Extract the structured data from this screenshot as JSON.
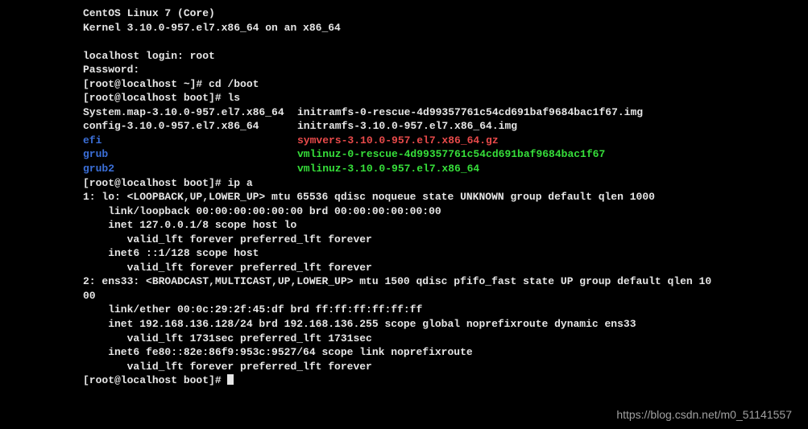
{
  "banner": {
    "line1": "CentOS Linux 7 (Core)",
    "line2": "Kernel 3.10.0-957.el7.x86_64 on an x86_64"
  },
  "login": {
    "prompt": "localhost login: ",
    "user": "root",
    "pw_prompt": "Password:"
  },
  "prompt_home": "[root@localhost ~]# ",
  "prompt_boot": "[root@localhost boot]# ",
  "cmd_cd": "cd /boot",
  "cmd_ls": "ls",
  "cmd_ip": "ip a",
  "ls": {
    "c0r0": "System.map-3.10.0-957.el7.x86_64",
    "c1r0": "initramfs-0-rescue-4d99357761c54cd691baf9684bac1f67.img",
    "c0r1": "config-3.10.0-957.el7.x86_64",
    "c1r1": "initramfs-3.10.0-957.el7.x86_64.img",
    "c0r2": "efi",
    "c1r2": "symvers-3.10.0-957.el7.x86_64.gz",
    "c0r3": "grub",
    "c1r3": "vmlinuz-0-rescue-4d99357761c54cd691baf9684bac1f67",
    "c0r4": "grub2",
    "c1r4": "vmlinuz-3.10.0-957.el7.x86_64"
  },
  "ip": {
    "l1": "1: lo: <LOOPBACK,UP,LOWER_UP> mtu 65536 qdisc noqueue state UNKNOWN group default qlen 1000",
    "l2": "    link/loopback 00:00:00:00:00:00 brd 00:00:00:00:00:00",
    "l3": "    inet 127.0.0.1/8 scope host lo",
    "l4": "       valid_lft forever preferred_lft forever",
    "l5": "    inet6 ::1/128 scope host",
    "l6": "       valid_lft forever preferred_lft forever",
    "l7a": "2: ens33: <BROADCAST,MULTICAST,UP,LOWER_UP> mtu 1500 qdisc pfifo_fast state UP group default qlen 10",
    "l7b": "00",
    "l8": "    link/ether 00:0c:29:2f:45:df brd ff:ff:ff:ff:ff:ff",
    "l9": "    inet 192.168.136.128/24 brd 192.168.136.255 scope global noprefixroute dynamic ens33",
    "l10": "       valid_lft 1731sec preferred_lft 1731sec",
    "l11": "    inet6 fe80::82e:86f9:953c:9527/64 scope link noprefixroute",
    "l12": "       valid_lft forever preferred_lft forever"
  },
  "watermark": "https://blog.csdn.net/m0_51141557"
}
